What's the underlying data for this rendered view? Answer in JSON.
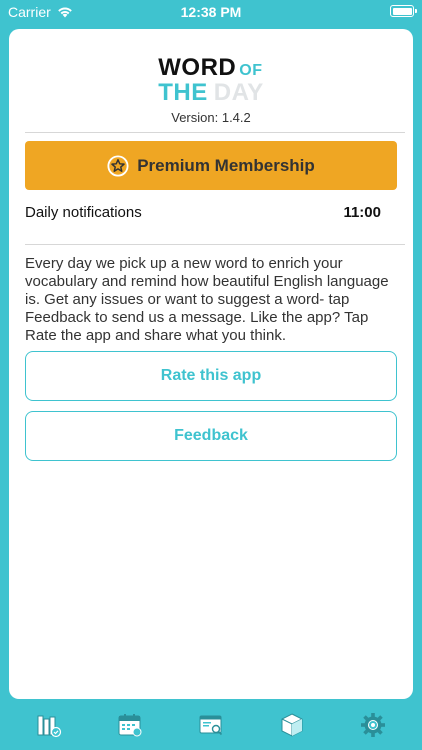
{
  "status_bar": {
    "carrier": "Carrier",
    "time": "12:38 PM"
  },
  "logo": {
    "word": "WORD",
    "of": "OF",
    "the": "THE",
    "day": "DAY"
  },
  "version": "Version: 1.4.2",
  "premium": {
    "label": "Premium Membership"
  },
  "notifications": {
    "label": "Daily notifications",
    "time": "11:00"
  },
  "description": "Every day we pick up a new word to enrich your vocabulary and remind how  beautiful English language is. Get any issues or want to suggest a word- tap Feedback to send us a message. Like the app? Tap Rate the app and share what you think.",
  "buttons": {
    "rate": "Rate this app",
    "feedback": "Feedback"
  },
  "tabbar": {
    "items": [
      {
        "icon": "books-icon"
      },
      {
        "icon": "calendar-icon"
      },
      {
        "icon": "browser-search-icon"
      },
      {
        "icon": "box-icon"
      },
      {
        "icon": "settings-gear-icon",
        "selected": true
      }
    ]
  },
  "colors": {
    "accent": "#3fc3cf",
    "premium": "#efa623",
    "background": "#3fc3cf"
  }
}
